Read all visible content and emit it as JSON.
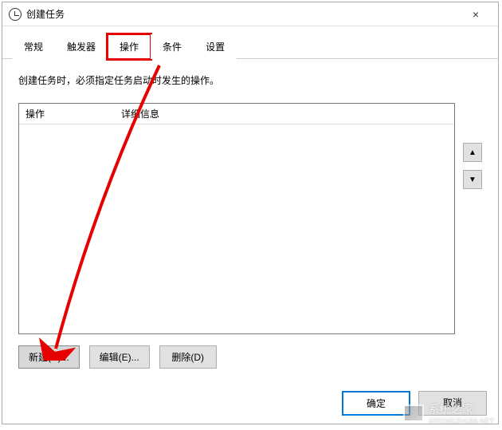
{
  "window": {
    "title": "创建任务",
    "close": "×"
  },
  "tabs": [
    {
      "label": "常规"
    },
    {
      "label": "触发器"
    },
    {
      "label": "操作",
      "active": true
    },
    {
      "label": "条件"
    },
    {
      "label": "设置"
    }
  ],
  "content": {
    "description": "创建任务时，必须指定任务启动时发生的操作。",
    "columns": {
      "action": "操作",
      "details": "详细信息"
    }
  },
  "side": {
    "up": "▲",
    "down": "▼"
  },
  "buttons": {
    "new": "新建(N)...",
    "edit": "编辑(E)...",
    "delete": "删除(D)"
  },
  "footer": {
    "ok": "确定",
    "cancel": "取消"
  },
  "watermark": {
    "title": "系统之家",
    "url": "XITONGZHIJIA.NET"
  }
}
